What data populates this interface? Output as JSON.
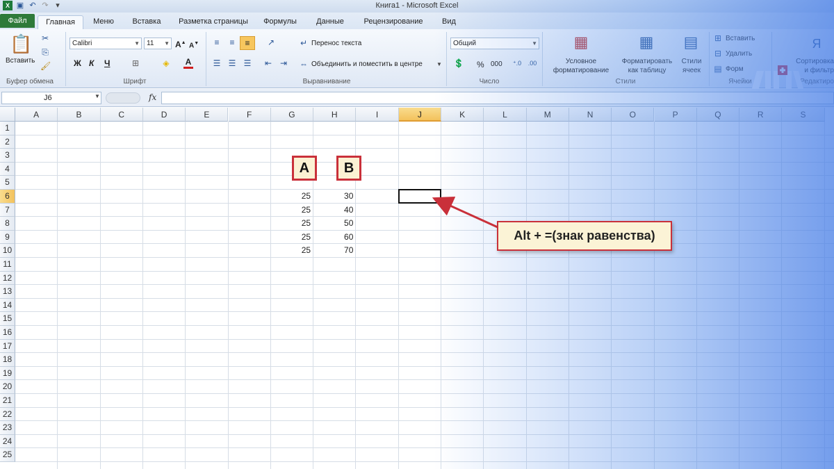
{
  "window": {
    "title": "Книга1  -  Microsoft Excel"
  },
  "tabs": [
    "Файл",
    "Главная",
    "Меню",
    "Вставка",
    "Разметка страницы",
    "Формулы",
    "Данные",
    "Рецензирование",
    "Вид"
  ],
  "active_tab": "Главная",
  "ribbon": {
    "paste_label": "Вставить",
    "clipboard_group": "Буфер обмена",
    "font_name": "Calibri",
    "font_size": "11",
    "bold": "Ж",
    "italic": "К",
    "underline": "Ч",
    "font_group": "Шрифт",
    "wrap_text": "Перенос текста",
    "merge_center": "Объединить и поместить в центре",
    "alignment_group": "Выравнивание",
    "number_format": "Общий",
    "percent": "%",
    "thousands": "000",
    "number_group": "Число",
    "conditional_formatting": "Условное форматирование",
    "format_as_table": "Форматировать как таблицу",
    "cell_styles": "Стили ячеек",
    "styles_group": "Стили",
    "insert": "Вставить",
    "delete": "Удалить",
    "format": "Форм",
    "cells_group": "Ячейки",
    "sort_filter": "Сортировка и фильтр",
    "editing_group": "Редактиро"
  },
  "formula_bar": {
    "name_box": "J6",
    "fx": "fx",
    "formula": ""
  },
  "grid": {
    "columns": [
      "A",
      "B",
      "C",
      "D",
      "E",
      "F",
      "G",
      "H",
      "I",
      "J",
      "K",
      "L",
      "M",
      "N",
      "O",
      "P",
      "Q",
      "R",
      "S"
    ],
    "rows": [
      "1",
      "2",
      "3",
      "4",
      "5",
      "6",
      "7",
      "8",
      "9",
      "10",
      "11",
      "12",
      "13",
      "14",
      "15",
      "16",
      "17",
      "18",
      "19",
      "20",
      "21",
      "22",
      "23",
      "24",
      "25"
    ],
    "selected_column": "J",
    "selected_row": "6",
    "label_a": "A",
    "label_b": "B",
    "col_g_values": [
      "25",
      "25",
      "25",
      "25",
      "25"
    ],
    "col_h_values": [
      "30",
      "40",
      "50",
      "60",
      "70"
    ]
  },
  "callout": {
    "text": "Alt + =(знак равенства)"
  },
  "colors": {
    "accent_red": "#c9303a",
    "callout_bg": "#fbf3d6",
    "file_tab": "#2e7a3a",
    "selection": "#f3c25c"
  }
}
